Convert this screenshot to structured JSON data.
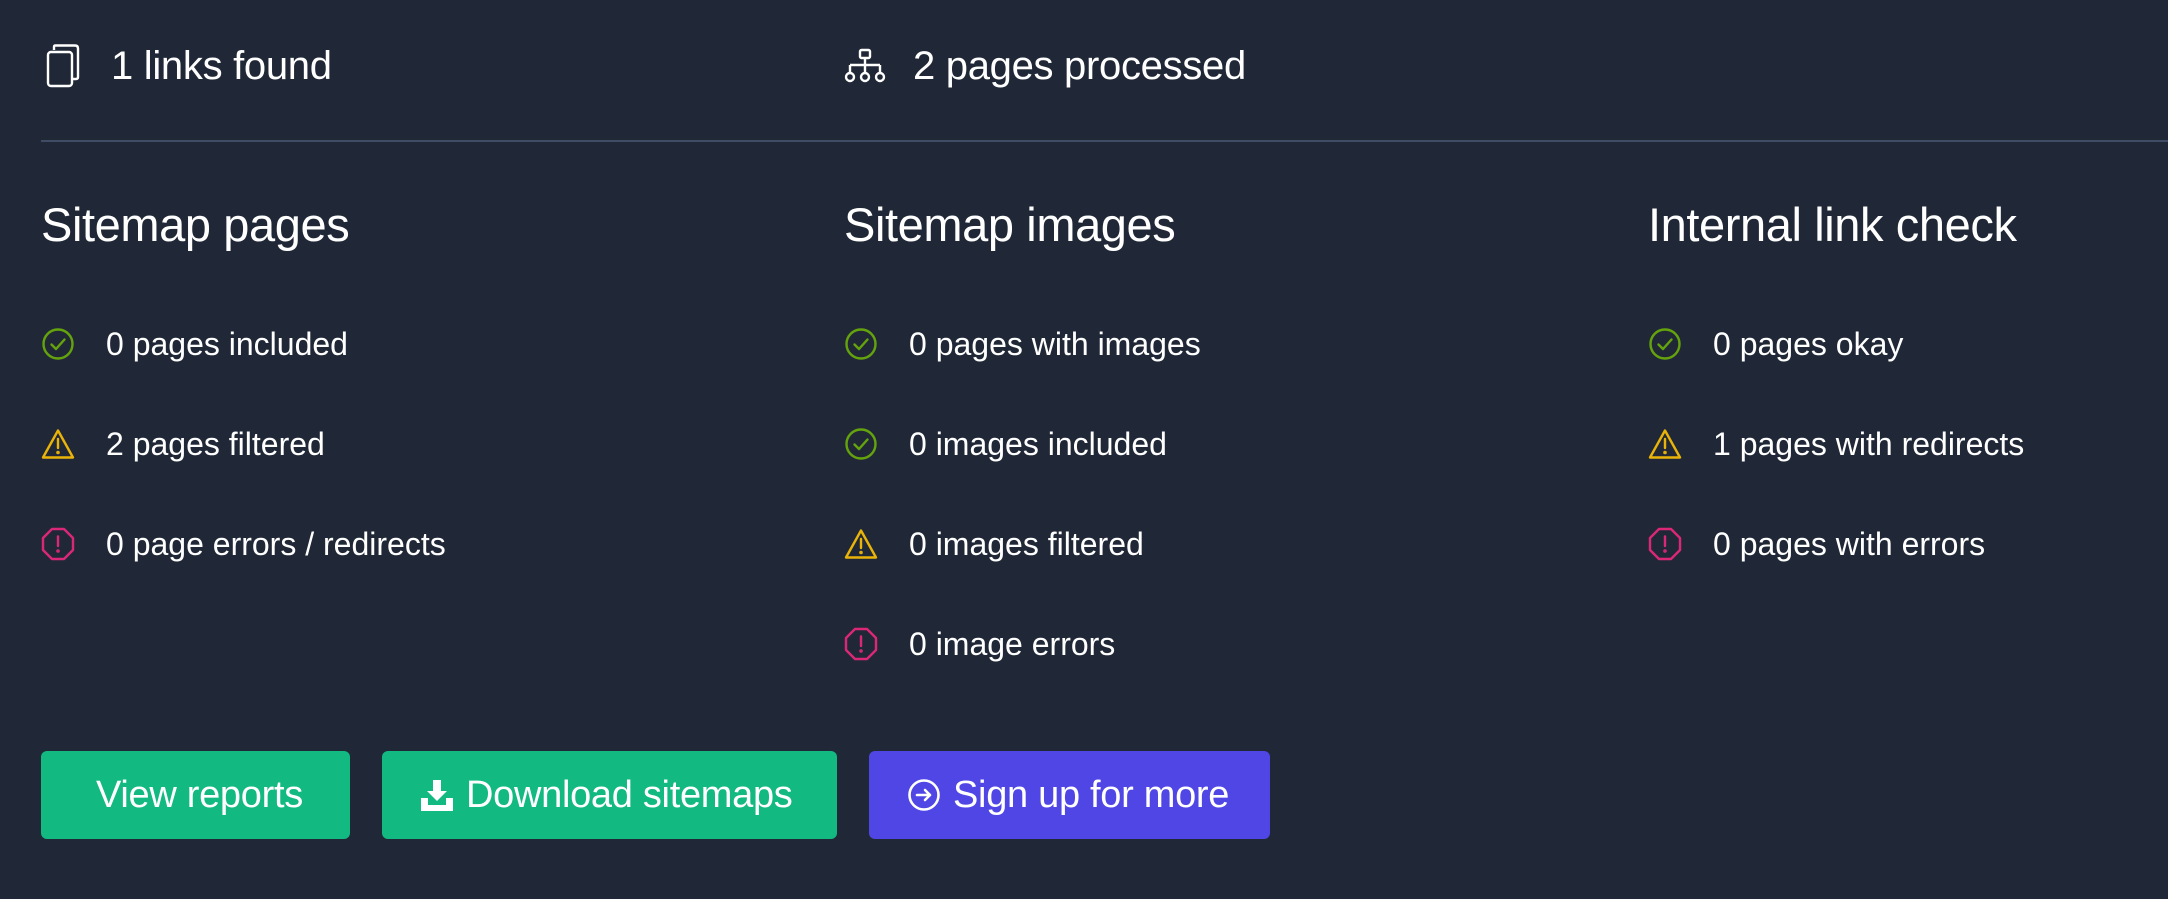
{
  "stats": {
    "links": {
      "text": "1 links found",
      "icon": "copy-icon"
    },
    "pages": {
      "text": "2 pages processed",
      "icon": "sitemap-icon"
    }
  },
  "colors": {
    "background": "#202837",
    "success": "#65a30d",
    "warning": "#eab308",
    "error": "#db2777",
    "green_button": "#12b981",
    "purple_button": "#4f46e5",
    "divider": "#3f4c63"
  },
  "columns": [
    {
      "title": "Sitemap pages",
      "items": [
        {
          "status": "success",
          "icon": "check-circle-icon",
          "label": "0 pages included"
        },
        {
          "status": "warning",
          "icon": "warning-triangle-icon",
          "label": "2 pages filtered"
        },
        {
          "status": "error",
          "icon": "error-octagon-icon",
          "label": "0 page errors / redirects"
        }
      ]
    },
    {
      "title": "Sitemap images",
      "items": [
        {
          "status": "success",
          "icon": "check-circle-icon",
          "label": "0 pages with images"
        },
        {
          "status": "success",
          "icon": "check-circle-icon",
          "label": "0 images included"
        },
        {
          "status": "warning",
          "icon": "warning-triangle-icon",
          "label": "0 images filtered"
        },
        {
          "status": "error",
          "icon": "error-octagon-icon",
          "label": "0 image errors"
        }
      ]
    },
    {
      "title": "Internal link check",
      "items": [
        {
          "status": "success",
          "icon": "check-circle-icon",
          "label": "0 pages okay"
        },
        {
          "status": "warning",
          "icon": "warning-triangle-icon",
          "label": "1 pages with redirects"
        },
        {
          "status": "error",
          "icon": "error-octagon-icon",
          "label": "0 pages with errors"
        }
      ]
    }
  ],
  "actions": {
    "view_reports": "View reports",
    "download_sitemaps": "Download sitemaps",
    "sign_up": "Sign up for more"
  }
}
